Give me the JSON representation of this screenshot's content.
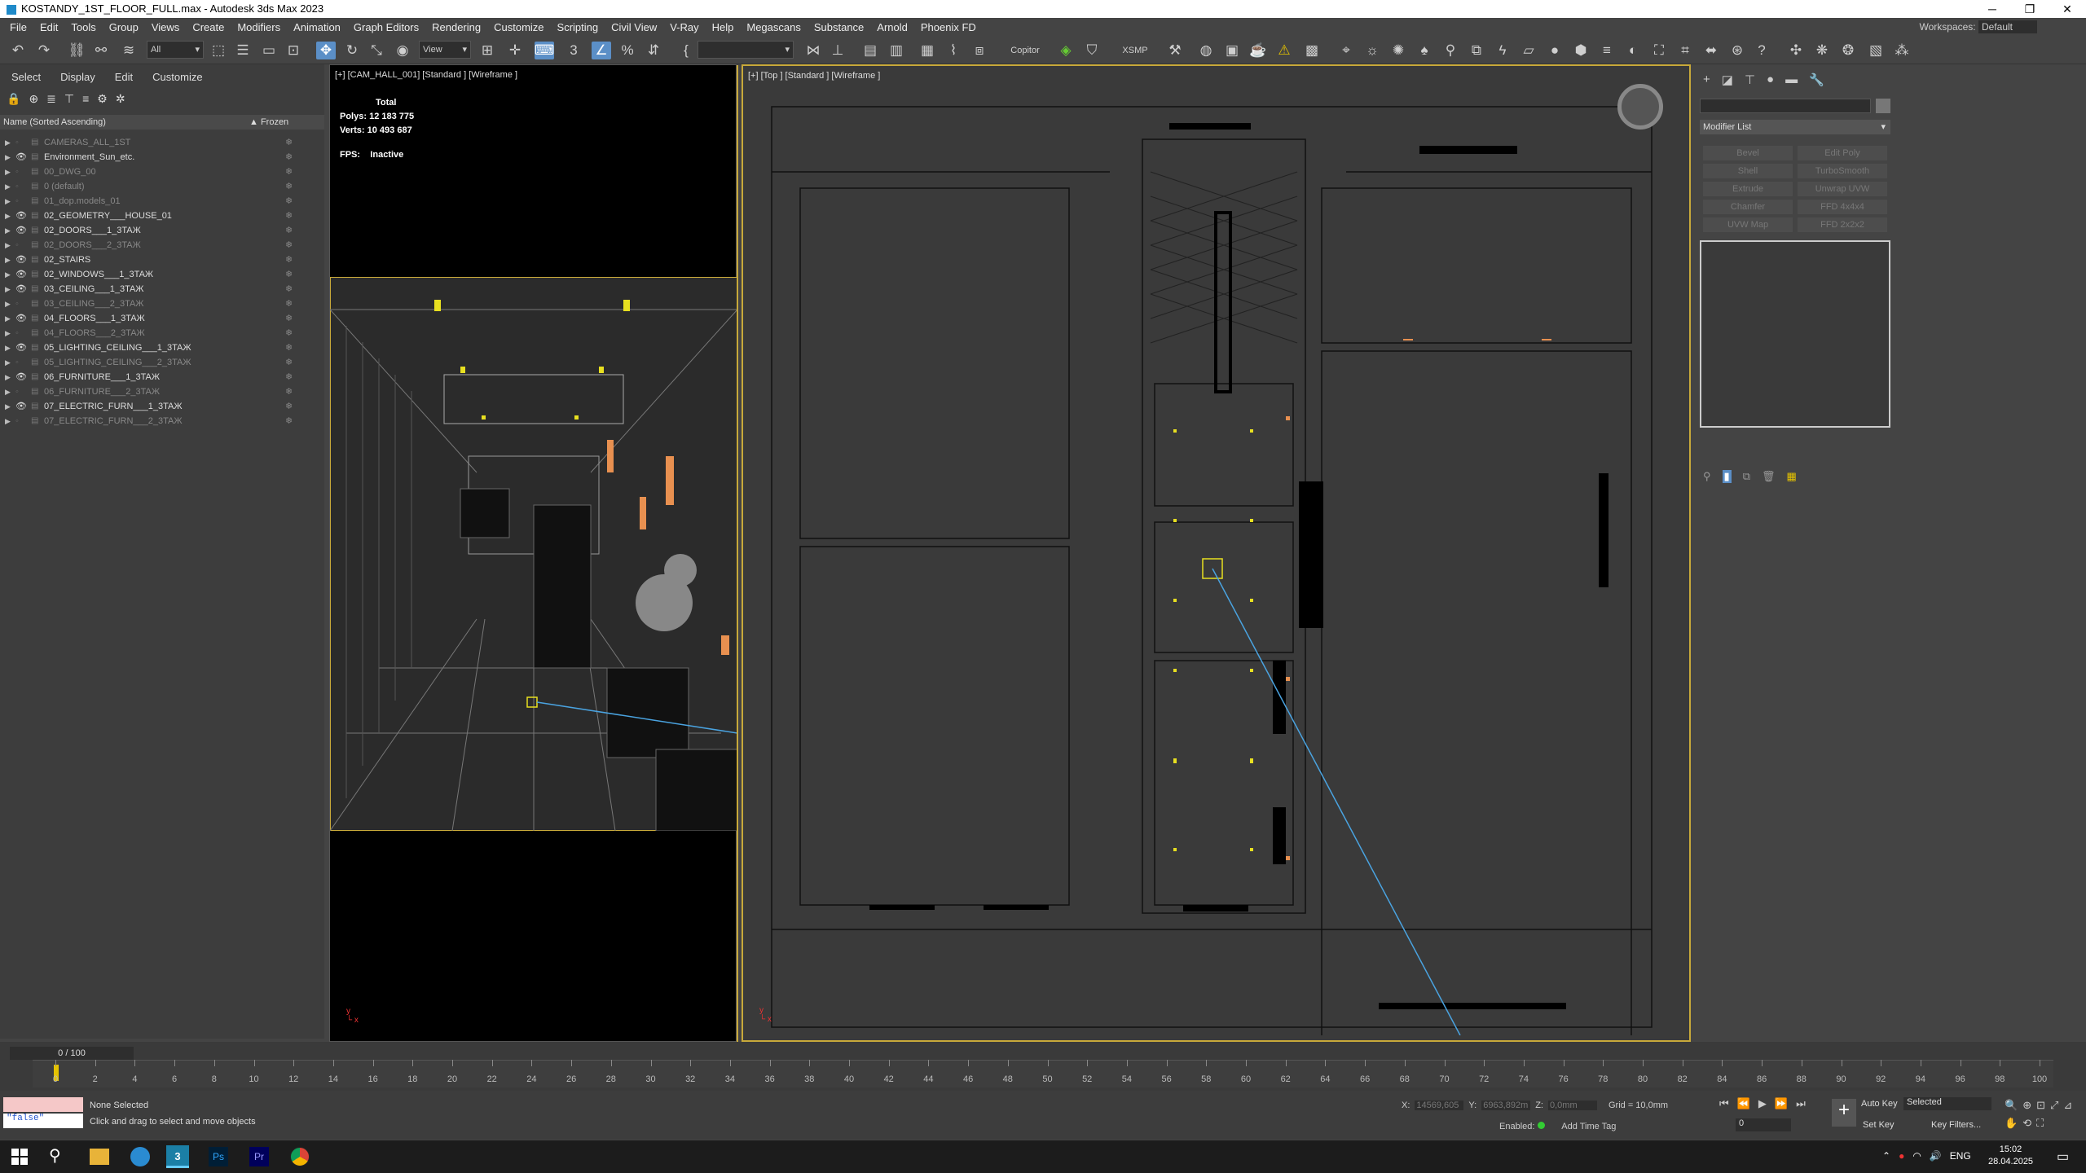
{
  "window": {
    "title": "KOSTANDY_1ST_FLOOR_FULL.max - Autodesk 3ds Max 2023",
    "min": "─",
    "max": "❐",
    "close": "✕"
  },
  "menu": [
    "File",
    "Edit",
    "Tools",
    "Group",
    "Views",
    "Create",
    "Modifiers",
    "Animation",
    "Graph Editors",
    "Rendering",
    "Customize",
    "Scripting",
    "Civil View",
    "V-Ray",
    "Help",
    "Megascans",
    "Substance",
    "Arnold",
    "Phoenix FD"
  ],
  "workspace": {
    "label": "Workspaces:",
    "value": "Default"
  },
  "toolbar": {
    "selection_filter": "All",
    "ref_coord": "View",
    "named_set": "",
    "copitor": "Copitor",
    "xsmp": "XSMP"
  },
  "scene_explorer": {
    "tabs": [
      "Select",
      "Display",
      "Edit",
      "Customize"
    ],
    "col_name": "Name (Sorted Ascending)",
    "col_frozen": "▲ Frozen",
    "layers": [
      {
        "name": "CAMERAS_ALL_1ST",
        "visible": false
      },
      {
        "name": "Environment_Sun_etc.",
        "visible": true
      },
      {
        "name": "00_DWG_00",
        "visible": false
      },
      {
        "name": "0 (default)",
        "visible": false
      },
      {
        "name": "01_dop.models_01",
        "visible": false
      },
      {
        "name": "02_GEOMETRY___HOUSE_01",
        "visible": true
      },
      {
        "name": "02_DOORS___1_3TAЖ",
        "visible": true
      },
      {
        "name": "02_DOORS___2_3TAЖ",
        "visible": false
      },
      {
        "name": "02_STAIRS",
        "visible": true
      },
      {
        "name": "02_WINDOWS___1_3TAЖ",
        "visible": true
      },
      {
        "name": "03_CEILING___1_3TAЖ",
        "visible": true
      },
      {
        "name": "03_CEILING___2_3TAЖ",
        "visible": false
      },
      {
        "name": "04_FLOORS___1_3TAЖ",
        "visible": true
      },
      {
        "name": "04_FLOORS___2_3TAЖ",
        "visible": false
      },
      {
        "name": "05_LIGHTING_CEILING___1_3TAЖ",
        "visible": true
      },
      {
        "name": "05_LIGHTING_CEILING___2_3TAЖ",
        "visible": false
      },
      {
        "name": "06_FURNITURE___1_3TAЖ",
        "visible": true
      },
      {
        "name": "06_FURNITURE___2_3TAЖ",
        "visible": false
      },
      {
        "name": "07_ELECTRIC_FURN___1_3TAЖ",
        "visible": true
      },
      {
        "name": "07_ELECTRIC_FURN___2_3TAЖ",
        "visible": false
      }
    ]
  },
  "viewport_left": {
    "label": "[+] [CAM_HALL_001] [Standard ] [Wireframe ]",
    "stats": {
      "total": "Total",
      "polys_label": "Polys:",
      "polys": "12 183 775",
      "verts_label": "Verts:",
      "verts": "10 493 687",
      "fps_label": "FPS:",
      "fps": "Inactive"
    }
  },
  "viewport_right": {
    "label": "[+] [Top ] [Standard ] [Wireframe ]"
  },
  "command_panel": {
    "modifier_list": "Modifier List",
    "buttons": [
      "Bevel",
      "Edit Poly",
      "Shell",
      "TurboSmooth",
      "Extrude",
      "Unwrap UVW",
      "Chamfer",
      "FFD 4x4x4",
      "UVW Map",
      "FFD 2x2x2"
    ]
  },
  "timeline": {
    "slider": "0 / 100",
    "ticks": [
      "0",
      "2",
      "4",
      "6",
      "8",
      "10",
      "12",
      "14",
      "16",
      "18",
      "20",
      "22",
      "24",
      "26",
      "28",
      "30",
      "32",
      "34",
      "36",
      "38",
      "40",
      "42",
      "44",
      "46",
      "48",
      "50",
      "52",
      "54",
      "56",
      "58",
      "60",
      "62",
      "64",
      "66",
      "68",
      "70",
      "72",
      "74",
      "76",
      "78",
      "80",
      "82",
      "84",
      "86",
      "88",
      "90",
      "92",
      "94",
      "96",
      "98",
      "100"
    ]
  },
  "status": {
    "selection": "None Selected",
    "prompt": "Click and drag to select and move objects",
    "maxscript": "\"false\"",
    "x_label": "X:",
    "x": "14569,605",
    "y_label": "Y:",
    "y": "6963,892m",
    "z_label": "Z:",
    "z": "0,0mm",
    "grid": "Grid = 10,0mm",
    "enabled": "Enabled:",
    "add_time_tag": "Add Time Tag",
    "auto_key": "Auto Key",
    "set_key": "Set Key",
    "key_mode": "Selected",
    "key_filters": "Key Filters...",
    "frame": "0"
  },
  "taskbar": {
    "lang": "ENG",
    "time": "15:02",
    "date": "28.04.2025"
  }
}
